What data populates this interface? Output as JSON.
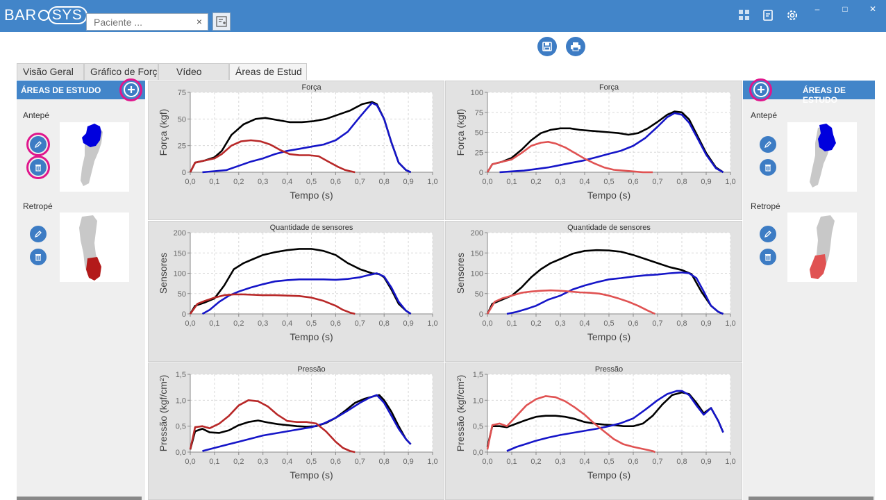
{
  "app": {
    "logo_left": "BAR",
    "logo_right": "SYS",
    "patient_placeholder": "Paciente ...",
    "clear_glyph": "×",
    "minimize": "–",
    "maximize": "□",
    "close": "✕"
  },
  "colors": {
    "titlebar": "#4285c9",
    "accent": "#3d7cc4",
    "highlight": "#e0168c",
    "black_series": "#000000",
    "blue_series": "#1515c8",
    "red_series": "#b82828",
    "lightred_series": "#e05252"
  },
  "toolbar": {
    "save_icon": "save-icon",
    "print_icon": "print-icon"
  },
  "tabs": [
    {
      "label": "Visão Geral"
    },
    {
      "label": "Gráfico de Forç"
    },
    {
      "label": "Vídeo"
    },
    {
      "label": "Áreas de Estud"
    }
  ],
  "left_panel": {
    "title": "ÁREAS DE ESTUDO",
    "areas": [
      {
        "label": "Antepé"
      },
      {
        "label": "Retropé"
      }
    ]
  },
  "right_panel": {
    "title": "ÁREAS DE ESTUDO",
    "areas": [
      {
        "label": "Antepé"
      },
      {
        "label": "Retropé"
      }
    ]
  },
  "chart_data": [
    {
      "type": "line",
      "title": "Força",
      "xlabel": "Tempo (s)",
      "ylabel": "Força (kgf)",
      "xlim": [
        0,
        1
      ],
      "ylim": [
        0,
        75
      ],
      "yticks": [
        0,
        25,
        50,
        75
      ],
      "xticks": [
        "0,0",
        "0,1",
        "0,2",
        "0,3",
        "0,4",
        "0,5",
        "0,6",
        "0,7",
        "0,8",
        "0,9",
        "1,0"
      ],
      "series": [
        {
          "color": "#000000",
          "x": [
            0,
            0.02,
            0.06,
            0.1,
            0.13,
            0.17,
            0.22,
            0.27,
            0.31,
            0.36,
            0.41,
            0.46,
            0.51,
            0.56,
            0.61,
            0.66,
            0.71,
            0.75,
            0.77,
            0.8,
            0.83,
            0.86,
            0.89,
            0.91
          ],
          "y": [
            0,
            9,
            11,
            14,
            20,
            35,
            45,
            50,
            51,
            49,
            47,
            47,
            48,
            50,
            54,
            58,
            64,
            66,
            64,
            50,
            28,
            9,
            2,
            0
          ]
        },
        {
          "color": "#1515c8",
          "x": [
            0.05,
            0.1,
            0.15,
            0.2,
            0.25,
            0.3,
            0.35,
            0.4,
            0.45,
            0.5,
            0.55,
            0.6,
            0.65,
            0.7,
            0.73,
            0.75,
            0.77,
            0.8,
            0.83,
            0.86,
            0.89,
            0.91
          ],
          "y": [
            0,
            1,
            2,
            6,
            10,
            13,
            17,
            20,
            22,
            24,
            26,
            30,
            38,
            52,
            60,
            65,
            63,
            50,
            28,
            9,
            2,
            0
          ]
        },
        {
          "color": "#b82828",
          "x": [
            0,
            0.02,
            0.06,
            0.1,
            0.13,
            0.17,
            0.21,
            0.25,
            0.29,
            0.33,
            0.37,
            0.41,
            0.45,
            0.49,
            0.53,
            0.57,
            0.61,
            0.64,
            0.66,
            0.68
          ],
          "y": [
            0,
            9,
            11,
            13,
            17,
            25,
            29,
            30,
            29,
            26,
            21,
            17,
            16,
            16,
            15,
            10,
            5,
            2,
            1,
            0
          ]
        }
      ]
    },
    {
      "type": "line",
      "title": "Força",
      "xlabel": "Tempo (s)",
      "ylabel": "Força (kgf)",
      "xlim": [
        0,
        1
      ],
      "ylim": [
        0,
        100
      ],
      "yticks": [
        0,
        25,
        50,
        75,
        100
      ],
      "xticks": [
        "0,0",
        "0,1",
        "0,2",
        "0,3",
        "0,4",
        "0,5",
        "0,6",
        "0,7",
        "0,8",
        "0,9",
        "1,0"
      ],
      "series": [
        {
          "color": "#000000",
          "x": [
            0,
            0.02,
            0.06,
            0.1,
            0.14,
            0.18,
            0.22,
            0.26,
            0.3,
            0.34,
            0.38,
            0.42,
            0.46,
            0.5,
            0.54,
            0.58,
            0.62,
            0.66,
            0.7,
            0.74,
            0.77,
            0.8,
            0.83,
            0.86,
            0.9,
            0.94,
            0.97
          ],
          "y": [
            0,
            10,
            13,
            18,
            28,
            40,
            49,
            53,
            55,
            55,
            53,
            52,
            51,
            50,
            49,
            47,
            49,
            55,
            63,
            72,
            76,
            75,
            66,
            48,
            24,
            6,
            0
          ]
        },
        {
          "color": "#1515c8",
          "x": [
            0.05,
            0.1,
            0.15,
            0.2,
            0.25,
            0.3,
            0.35,
            0.4,
            0.45,
            0.5,
            0.55,
            0.6,
            0.65,
            0.7,
            0.74,
            0.77,
            0.8,
            0.83,
            0.86,
            0.9,
            0.94,
            0.97
          ],
          "y": [
            0,
            1,
            2,
            4,
            6,
            9,
            12,
            15,
            19,
            23,
            27,
            33,
            43,
            57,
            69,
            74,
            72,
            62,
            45,
            22,
            5,
            0
          ]
        },
        {
          "color": "#e05252",
          "x": [
            0,
            0.02,
            0.06,
            0.1,
            0.14,
            0.18,
            0.22,
            0.25,
            0.28,
            0.32,
            0.36,
            0.4,
            0.44,
            0.48,
            0.52,
            0.56,
            0.6,
            0.64,
            0.68
          ],
          "y": [
            0,
            10,
            13,
            16,
            24,
            33,
            37,
            38,
            36,
            31,
            24,
            17,
            11,
            6,
            3,
            2,
            1,
            0,
            0
          ]
        }
      ]
    },
    {
      "type": "line",
      "title": "Quantidade de sensores",
      "xlabel": "Tempo (s)",
      "ylabel": "Sensores",
      "xlim": [
        0,
        1
      ],
      "ylim": [
        0,
        200
      ],
      "yticks": [
        0,
        50,
        100,
        150,
        200
      ],
      "xticks": [
        "0,0",
        "0,1",
        "0,2",
        "0,3",
        "0,4",
        "0,5",
        "0,6",
        "0,7",
        "0,8",
        "0,9",
        "1,0"
      ],
      "series": [
        {
          "color": "#000000",
          "x": [
            0,
            0.02,
            0.06,
            0.1,
            0.14,
            0.18,
            0.22,
            0.26,
            0.3,
            0.35,
            0.4,
            0.45,
            0.5,
            0.55,
            0.6,
            0.65,
            0.7,
            0.75,
            0.78,
            0.8,
            0.83,
            0.86,
            0.89,
            0.91
          ],
          "y": [
            0,
            20,
            28,
            38,
            70,
            110,
            125,
            135,
            145,
            152,
            157,
            160,
            160,
            155,
            145,
            125,
            110,
            100,
            98,
            90,
            60,
            25,
            8,
            0
          ]
        },
        {
          "color": "#1515c8",
          "x": [
            0.05,
            0.08,
            0.12,
            0.16,
            0.2,
            0.25,
            0.3,
            0.35,
            0.4,
            0.45,
            0.5,
            0.55,
            0.6,
            0.65,
            0.7,
            0.74,
            0.77,
            0.8,
            0.83,
            0.86,
            0.89,
            0.91
          ],
          "y": [
            0,
            10,
            30,
            45,
            55,
            65,
            73,
            80,
            83,
            85,
            85,
            85,
            84,
            86,
            90,
            96,
            100,
            92,
            65,
            30,
            8,
            0
          ]
        },
        {
          "color": "#b82828",
          "x": [
            0,
            0.03,
            0.06,
            0.1,
            0.14,
            0.18,
            0.22,
            0.26,
            0.3,
            0.35,
            0.4,
            0.45,
            0.5,
            0.55,
            0.6,
            0.63,
            0.66,
            0.68
          ],
          "y": [
            0,
            25,
            32,
            40,
            46,
            48,
            48,
            47,
            46,
            46,
            45,
            44,
            40,
            32,
            20,
            10,
            3,
            0
          ]
        }
      ]
    },
    {
      "type": "line",
      "title": "Quantidade de sensores",
      "xlabel": "Tempo (s)",
      "ylabel": "Sensores",
      "xlim": [
        0,
        1
      ],
      "ylim": [
        0,
        200
      ],
      "yticks": [
        0,
        50,
        100,
        150,
        200
      ],
      "xticks": [
        "0,0",
        "0,1",
        "0,2",
        "0,3",
        "0,4",
        "0,5",
        "0,6",
        "0,7",
        "0,8",
        "0,9",
        "1,0"
      ],
      "series": [
        {
          "color": "#000000",
          "x": [
            0,
            0.02,
            0.06,
            0.1,
            0.14,
            0.18,
            0.22,
            0.26,
            0.3,
            0.35,
            0.4,
            0.45,
            0.5,
            0.55,
            0.6,
            0.65,
            0.7,
            0.75,
            0.8,
            0.84,
            0.88,
            0.92,
            0.95,
            0.97
          ],
          "y": [
            0,
            25,
            35,
            45,
            65,
            90,
            110,
            125,
            135,
            148,
            155,
            157,
            156,
            153,
            145,
            135,
            125,
            115,
            108,
            98,
            55,
            20,
            5,
            0
          ]
        },
        {
          "color": "#1515c8",
          "x": [
            0.08,
            0.12,
            0.16,
            0.2,
            0.25,
            0.3,
            0.35,
            0.4,
            0.45,
            0.5,
            0.55,
            0.6,
            0.65,
            0.7,
            0.75,
            0.8,
            0.83,
            0.86,
            0.89,
            0.92,
            0.95,
            0.97
          ],
          "y": [
            0,
            5,
            12,
            20,
            35,
            45,
            60,
            70,
            78,
            85,
            88,
            92,
            95,
            97,
            100,
            102,
            100,
            88,
            55,
            20,
            5,
            0
          ]
        },
        {
          "color": "#e05252",
          "x": [
            0,
            0.03,
            0.06,
            0.1,
            0.14,
            0.18,
            0.22,
            0.26,
            0.3,
            0.34,
            0.38,
            0.42,
            0.46,
            0.5,
            0.54,
            0.58,
            0.62,
            0.66,
            0.69
          ],
          "y": [
            0,
            30,
            38,
            45,
            52,
            55,
            57,
            58,
            57,
            55,
            53,
            52,
            50,
            45,
            38,
            30,
            20,
            8,
            0
          ]
        }
      ]
    },
    {
      "type": "line",
      "title": "Pressão",
      "xlabel": "Tempo (s)",
      "ylabel": "Pressão (kgf/cm²)",
      "xlim": [
        0,
        1
      ],
      "ylim": [
        0,
        1.5
      ],
      "yticks": [
        "0,0",
        "0,5",
        "1,0",
        "1,5"
      ],
      "xticks": [
        "0,0",
        "0,1",
        "0,2",
        "0,3",
        "0,4",
        "0,5",
        "0,6",
        "0,7",
        "0,8",
        "0,9",
        "1,0"
      ],
      "series": [
        {
          "color": "#000000",
          "x": [
            0,
            0.02,
            0.05,
            0.08,
            0.12,
            0.16,
            0.2,
            0.24,
            0.28,
            0.32,
            0.36,
            0.4,
            0.44,
            0.48,
            0.52,
            0.56,
            0.6,
            0.64,
            0.68,
            0.72,
            0.76,
            0.78,
            0.8,
            0.83,
            0.86,
            0.89,
            0.91
          ],
          "y": [
            0.05,
            0.4,
            0.45,
            0.38,
            0.37,
            0.42,
            0.52,
            0.58,
            0.61,
            0.57,
            0.54,
            0.52,
            0.5,
            0.49,
            0.5,
            0.56,
            0.66,
            0.8,
            0.95,
            1.03,
            1.08,
            1.1,
            1.0,
            0.78,
            0.5,
            0.25,
            0.15
          ]
        },
        {
          "color": "#1515c8",
          "x": [
            0.05,
            0.1,
            0.15,
            0.2,
            0.25,
            0.3,
            0.35,
            0.4,
            0.45,
            0.5,
            0.55,
            0.6,
            0.65,
            0.7,
            0.74,
            0.77,
            0.8,
            0.83,
            0.86,
            0.89,
            0.91
          ],
          "y": [
            0.02,
            0.08,
            0.14,
            0.2,
            0.26,
            0.32,
            0.36,
            0.4,
            0.44,
            0.48,
            0.55,
            0.66,
            0.8,
            0.95,
            1.05,
            1.1,
            0.95,
            0.7,
            0.45,
            0.25,
            0.15
          ]
        },
        {
          "color": "#b82828",
          "x": [
            0,
            0.02,
            0.05,
            0.08,
            0.12,
            0.16,
            0.2,
            0.24,
            0.28,
            0.32,
            0.36,
            0.4,
            0.44,
            0.48,
            0.52,
            0.56,
            0.6,
            0.63,
            0.66,
            0.68
          ],
          "y": [
            0.05,
            0.48,
            0.5,
            0.46,
            0.55,
            0.7,
            0.9,
            1.0,
            0.98,
            0.88,
            0.72,
            0.6,
            0.58,
            0.58,
            0.55,
            0.4,
            0.2,
            0.08,
            0.02,
            0
          ]
        }
      ]
    },
    {
      "type": "line",
      "title": "Pressão",
      "xlabel": "Tempo (s)",
      "ylabel": "Pressão (kgf/cm²)",
      "xlim": [
        0,
        1
      ],
      "ylim": [
        0,
        1.5
      ],
      "yticks": [
        "0,0",
        "0,5",
        "1,0",
        "1,5"
      ],
      "xticks": [
        "0,0",
        "0,1",
        "0,2",
        "0,3",
        "0,4",
        "0,5",
        "0,6",
        "0,7",
        "0,8",
        "0,9",
        "1,0"
      ],
      "series": [
        {
          "color": "#000000",
          "x": [
            0,
            0.02,
            0.05,
            0.08,
            0.12,
            0.16,
            0.2,
            0.24,
            0.28,
            0.32,
            0.36,
            0.4,
            0.44,
            0.48,
            0.52,
            0.56,
            0.6,
            0.64,
            0.68,
            0.72,
            0.76,
            0.8,
            0.83,
            0.86,
            0.89,
            0.92,
            0.95,
            0.97
          ],
          "y": [
            0.1,
            0.5,
            0.5,
            0.48,
            0.55,
            0.62,
            0.68,
            0.7,
            0.7,
            0.68,
            0.64,
            0.58,
            0.55,
            0.53,
            0.52,
            0.5,
            0.5,
            0.55,
            0.7,
            0.92,
            1.1,
            1.15,
            1.12,
            0.95,
            0.75,
            0.85,
            0.6,
            0.38
          ]
        },
        {
          "color": "#1515c8",
          "x": [
            0.08,
            0.12,
            0.16,
            0.2,
            0.25,
            0.3,
            0.35,
            0.4,
            0.45,
            0.5,
            0.55,
            0.6,
            0.65,
            0.7,
            0.74,
            0.78,
            0.8,
            0.83,
            0.86,
            0.89,
            0.92,
            0.95,
            0.97
          ],
          "y": [
            0.02,
            0.1,
            0.16,
            0.22,
            0.28,
            0.33,
            0.37,
            0.41,
            0.45,
            0.5,
            0.56,
            0.65,
            0.82,
            1.0,
            1.12,
            1.18,
            1.18,
            1.1,
            0.9,
            0.72,
            0.85,
            0.6,
            0.38
          ]
        },
        {
          "color": "#e05252",
          "x": [
            0,
            0.02,
            0.05,
            0.08,
            0.12,
            0.16,
            0.2,
            0.24,
            0.28,
            0.32,
            0.36,
            0.4,
            0.44,
            0.48,
            0.52,
            0.56,
            0.6,
            0.64,
            0.68,
            0.69
          ],
          "y": [
            0.05,
            0.52,
            0.55,
            0.5,
            0.7,
            0.9,
            1.02,
            1.08,
            1.06,
            0.98,
            0.86,
            0.72,
            0.55,
            0.4,
            0.25,
            0.15,
            0.1,
            0.06,
            0.02,
            0
          ]
        }
      ]
    }
  ]
}
